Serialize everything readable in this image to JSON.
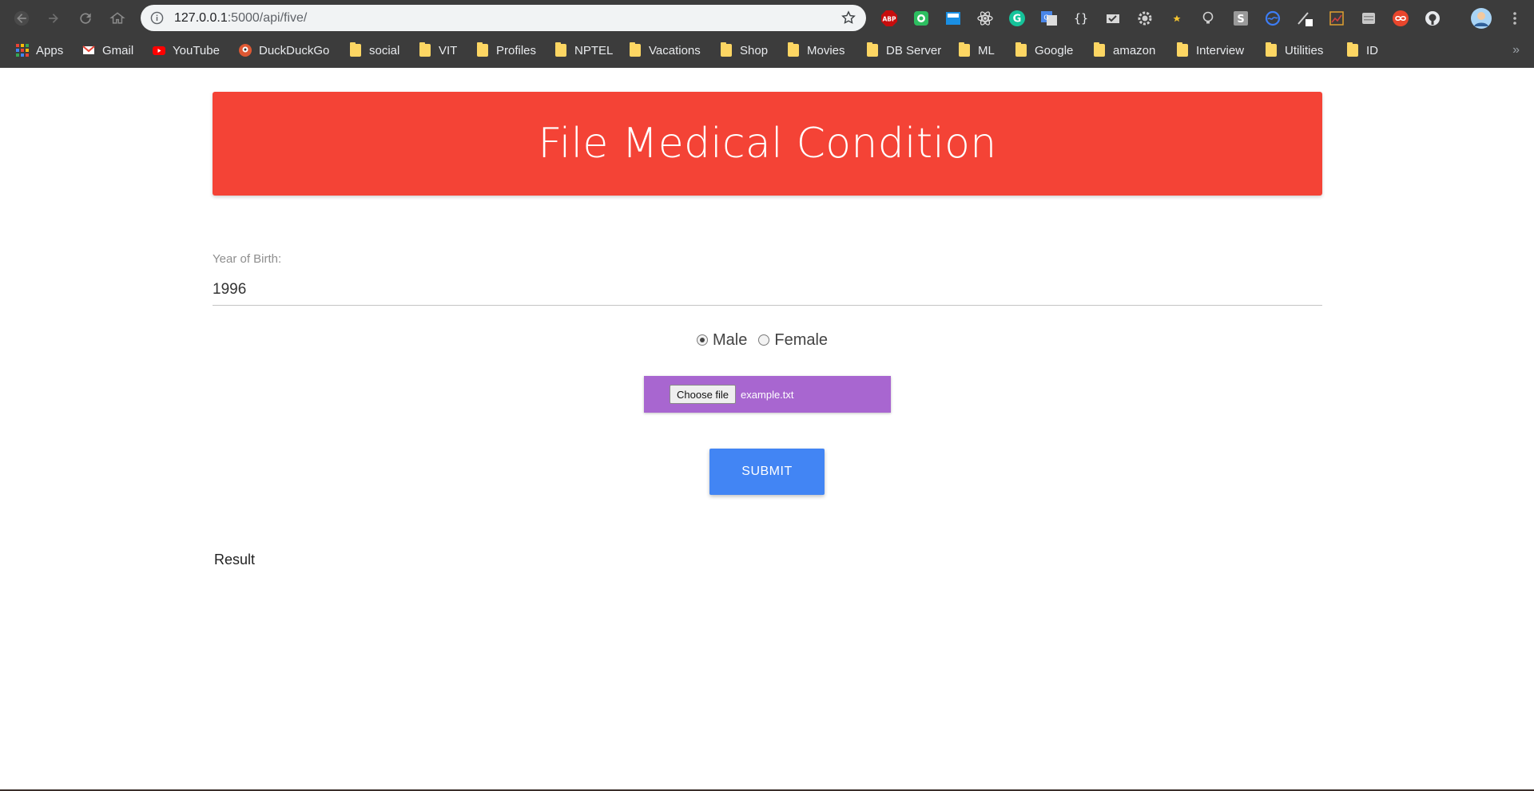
{
  "browser": {
    "url_host": "127.0.0.1",
    "url_rest": ":5000/api/five/",
    "extensions": [
      "abp-icon",
      "evernote-icon",
      "grammarly-like-icon",
      "react-devtools-icon",
      "grammarly-icon",
      "translate-icon",
      "json-viewer-icon",
      "checkmark-icon",
      "settings-gear-icon",
      "star-small-icon",
      "lightbulb-icon",
      "s-icon",
      "refresh-circle-icon",
      "pen-icon",
      "chart-icon",
      "note-icon",
      "infinity-icon",
      "github-icon"
    ],
    "bookmarks": [
      {
        "label": "Apps",
        "icon": "apps-grid-icon"
      },
      {
        "label": "Gmail",
        "icon": "gmail-icon"
      },
      {
        "label": "YouTube",
        "icon": "youtube-icon"
      },
      {
        "label": "DuckDuckGo",
        "icon": "duckduckgo-icon"
      },
      {
        "label": "social",
        "icon": "folder-icon"
      },
      {
        "label": "VIT",
        "icon": "folder-icon"
      },
      {
        "label": "Profiles",
        "icon": "folder-icon"
      },
      {
        "label": "NPTEL",
        "icon": "folder-icon"
      },
      {
        "label": "Vacations",
        "icon": "folder-icon"
      },
      {
        "label": "Shop",
        "icon": "folder-icon"
      },
      {
        "label": "Movies",
        "icon": "folder-icon"
      },
      {
        "label": "DB Server",
        "icon": "folder-icon"
      },
      {
        "label": "ML",
        "icon": "folder-icon"
      },
      {
        "label": "Google",
        "icon": "folder-icon"
      },
      {
        "label": "amazon",
        "icon": "folder-icon"
      },
      {
        "label": "Interview",
        "icon": "folder-icon"
      },
      {
        "label": "Utilities",
        "icon": "folder-icon"
      },
      {
        "label": "ID",
        "icon": "folder-icon"
      }
    ],
    "more_glyph": "»"
  },
  "page": {
    "title": "File Medical Condition",
    "yob_label": "Year of Birth:",
    "yob_value": "1996",
    "gender": {
      "male_label": "Male",
      "female_label": "Female",
      "selected": "Male"
    },
    "file": {
      "button_label": "Choose file",
      "filename": "example.txt"
    },
    "submit_label": "SUBMIT",
    "result_label": "Result"
  },
  "colors": {
    "banner": "#f44336",
    "file_box": "#a866d0",
    "submit": "#4285f4",
    "chrome_bg": "#3c3c3c"
  }
}
